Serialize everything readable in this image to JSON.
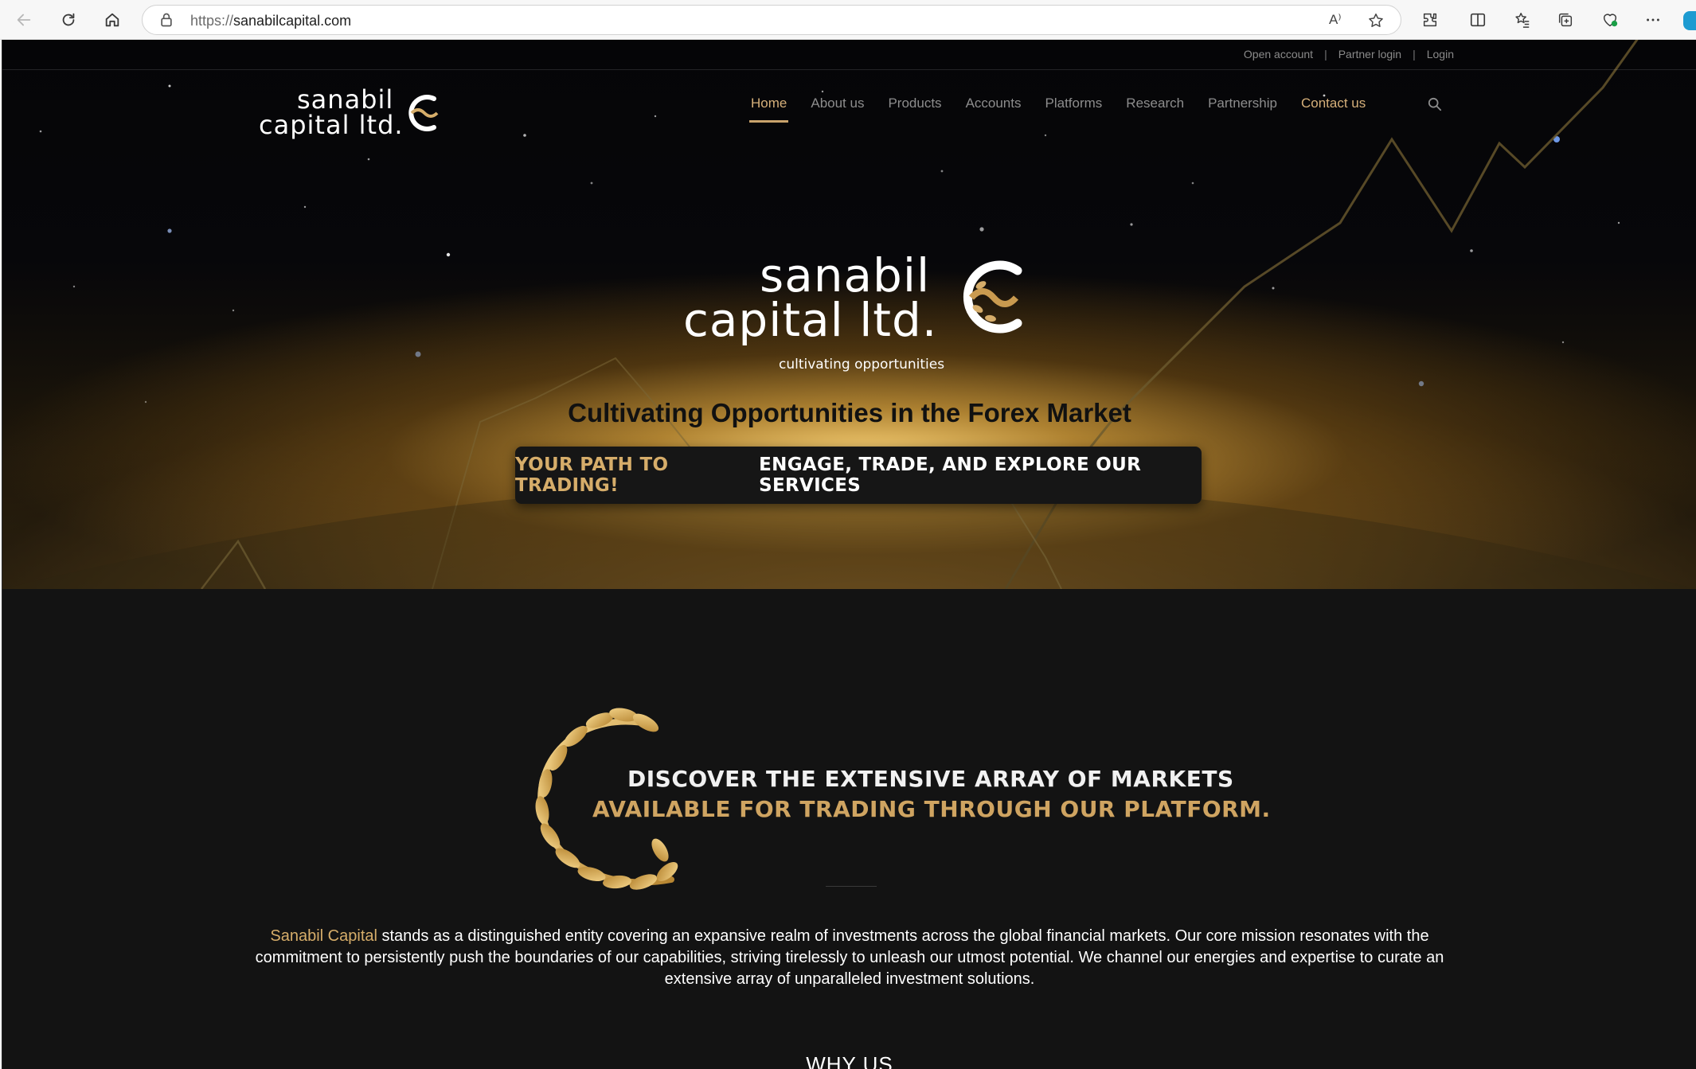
{
  "browser": {
    "url_protocol": "https://",
    "url_host": "sanabilcapital.com",
    "read_aloud_label": "A⁾"
  },
  "topbar": {
    "links": [
      "Open account",
      "Partner login",
      "Login"
    ],
    "separator": "|"
  },
  "logo": {
    "line1": "sanabil",
    "line2": "capital ltd.",
    "tagline": "cultivating opportunities"
  },
  "nav": {
    "items": [
      "Home",
      "About us",
      "Products",
      "Accounts",
      "Platforms",
      "Research",
      "Partnership",
      "Contact us"
    ],
    "active": "Home"
  },
  "hero": {
    "headline": "Cultivating Opportunities in the Forex Market",
    "cta_gold": "YOUR PATH TO TRADING!",
    "cta_white": "ENGAGE, TRADE, AND EXPLORE OUR SERVICES"
  },
  "discover": {
    "line1": "DISCOVER THE EXTENSIVE ARRAY OF MARKETS",
    "line2": "AVAILABLE FOR TRADING THROUGH OUR PLATFORM."
  },
  "about": {
    "brand": "Sanabil Capital",
    "text": " stands as a distinguished entity covering an expansive realm of investments across the global financial markets. Our core mission resonates with the commitment to persistently push the boundaries of our capabilities, striving tirelessly to unleash our utmost potential. We channel our energies and expertise to curate an extensive array of unparalleled investment solutions."
  },
  "why_us": {
    "heading": "WHY US"
  },
  "colors": {
    "gold": "#d6ad6a",
    "dark_bg": "#131313",
    "nav_inactive": "#8d8d8d"
  }
}
